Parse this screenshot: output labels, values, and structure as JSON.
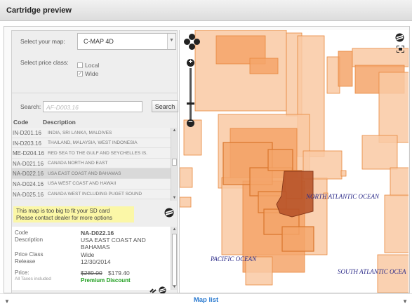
{
  "window": {
    "title": "Cartridge preview"
  },
  "form": {
    "map_label": "Select your map:",
    "map_value": "C-MAP 4D",
    "price_class_label": "Select price class:",
    "price_class_options": [
      {
        "label": "Local",
        "checked": false
      },
      {
        "label": "Wide",
        "checked": true
      }
    ],
    "search_label": "Search:",
    "search_placeholder": "AF-D003.16",
    "search_button": "Search"
  },
  "table": {
    "headers": [
      "Code",
      "Description"
    ],
    "rows": [
      {
        "code": "IN-D201.16",
        "description": "INDIA, SRI LANKA, MALDIVES"
      },
      {
        "code": "IN-D203.16",
        "description": "THAILAND, MALAYSIA, WEST INDONESIA"
      },
      {
        "code": "ME-D204.16",
        "description": "RED SEA TO THE GULF AND SEYCHELLES IS."
      },
      {
        "code": "NA-D021.16",
        "description": "CANADA NORTH AND EAST"
      },
      {
        "code": "NA-D022.16",
        "description": "USA EAST COAST AND BAHAMAS",
        "selected": true
      },
      {
        "code": "NA-D024.16",
        "description": "USA WEST COAST AND HAWAII"
      },
      {
        "code": "NA-D025.16",
        "description": "CANADA WEST INCLUDING PUGET SOUND"
      }
    ]
  },
  "warning": {
    "line1": "This map is too big to fit your SD card",
    "line2": "Please contact dealer for more options"
  },
  "details": {
    "code_label": "Code",
    "code_value": "NA-D022.16",
    "description_label": "Description",
    "description_value": "USA EAST COAST AND BAHAMAS",
    "price_class_label": "Price Class",
    "price_class_value": "Wide",
    "release_label": "Release",
    "release_value": "12/30/2014",
    "price_label": "Price:",
    "taxes_note": "All Taxes included",
    "old_price": "$289.00",
    "new_price": "$179.40",
    "discount_label": "Premium Discount"
  },
  "map": {
    "oceans": [
      "NORTH ATLANTIC OCEAN",
      "PACIFIC OCEAN",
      "SOUTH ATLANTIC OCEA"
    ],
    "coverage_colors": {
      "light": "#f9c9a3",
      "medium": "#f4a56a",
      "outline": "#e8873d",
      "selected": "#b8542a",
      "sea": "#ffffff"
    }
  },
  "footer": {
    "map_list_link": "Map list"
  }
}
